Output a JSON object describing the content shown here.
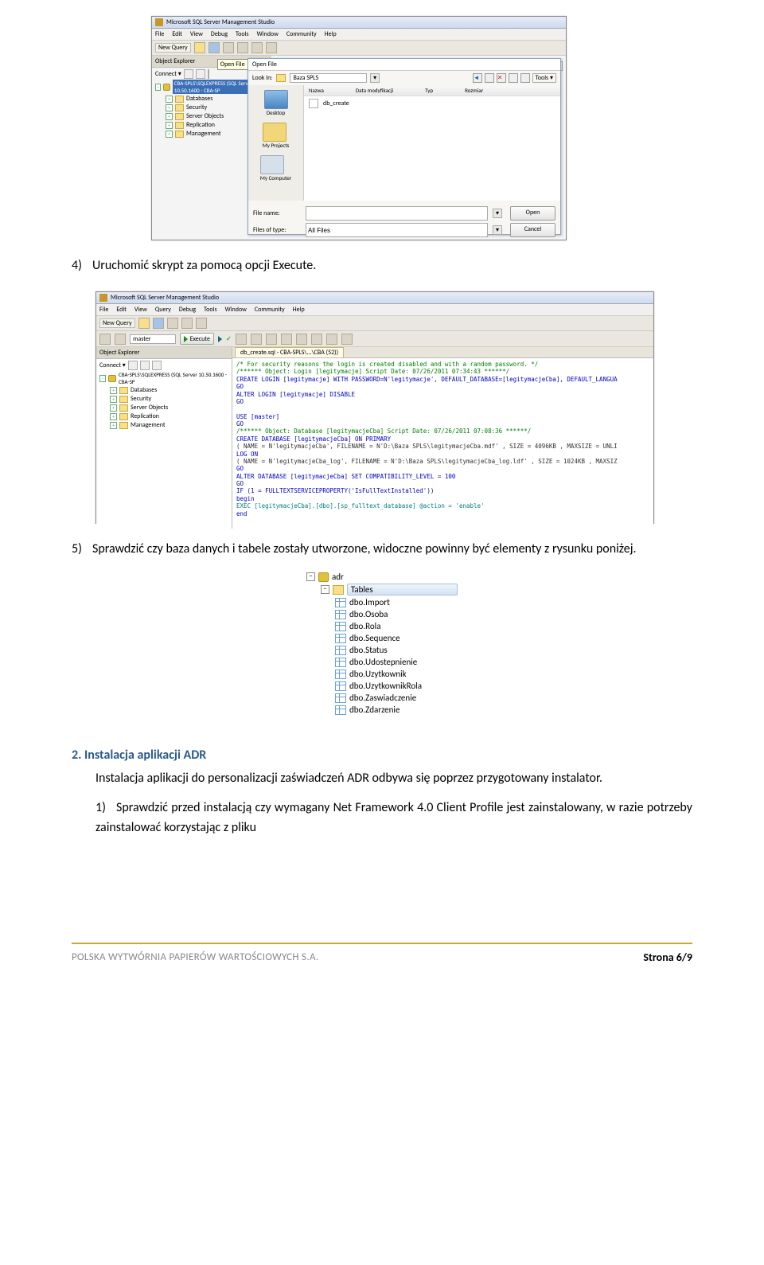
{
  "ssms": {
    "title": "Microsoft SQL Server Management Studio",
    "menu": [
      "File",
      "Edit",
      "View",
      "Debug",
      "Tools",
      "Window",
      "Community",
      "Help"
    ],
    "menu2": [
      "File",
      "Edit",
      "View",
      "Query",
      "Debug",
      "Tools",
      "Window",
      "Community",
      "Help"
    ],
    "new_query": "New Query",
    "oe_title": "Object Explorer",
    "connect": "Connect ▾",
    "server": "CBA-SPLS\\SQLEXPRESS (SQL Server 10.50.1600 - CBA-SP",
    "tree": [
      "Databases",
      "Security",
      "Server Objects",
      "Replication",
      "Management"
    ],
    "tooltip": "Open File",
    "exec": "Execute",
    "sub_master": "master"
  },
  "openfile": {
    "title": "Open File",
    "lookin_lbl": "Look in:",
    "lookin_val": "Baza SPLS",
    "tools": "Tools ▾",
    "side": [
      "Desktop",
      "My Projects",
      "My Computer"
    ],
    "headers": [
      "Nazwa",
      "Data modyfikacji",
      "Typ",
      "Rozmiar"
    ],
    "file": "db_create",
    "filename_lbl": "File name:",
    "filetype_lbl": "Files of type:",
    "filetype_val": "All Files",
    "open": "Open",
    "cancel": "Cancel"
  },
  "editor": {
    "tab": "db_create.sql - CBA-SPLS\\...\\CBA (52))",
    "lines": [
      {
        "t": "/* For security reasons the login is created disabled and with a random password. */",
        "c": "kw-green"
      },
      {
        "t": "/****** Object:  Login [legitymacje]    Script Date: 07/26/2011 07:34:43 ******/",
        "c": "kw-green"
      },
      {
        "t": "CREATE LOGIN [legitymacje] WITH PASSWORD=N'legitymacje', DEFAULT_DATABASE=[legitymacjeCba], DEFAULT_LANGUA",
        "c": "kw-blue"
      },
      {
        "t": "GO",
        "c": "kw-blue"
      },
      {
        "t": "ALTER LOGIN [legitymacje] DISABLE",
        "c": "kw-blue"
      },
      {
        "t": "GO",
        "c": "kw-blue"
      },
      {
        "t": "",
        "c": ""
      },
      {
        "t": "USE [master]",
        "c": "kw-blue"
      },
      {
        "t": "GO",
        "c": "kw-blue"
      },
      {
        "t": "/****** Object:  Database [legitymacjeCba]    Script Date: 07/26/2011 07:08:36 ******/",
        "c": "kw-green"
      },
      {
        "t": "CREATE DATABASE [legitymacjeCba] ON  PRIMARY",
        "c": "kw-blue"
      },
      {
        "t": "( NAME = N'legitymacjeCba', FILENAME = N'D:\\Baza SPLS\\legitymacjeCba.mdf' , SIZE = 4096KB , MAXSIZE = UNLI",
        "c": ""
      },
      {
        "t": " LOG ON",
        "c": "kw-blue"
      },
      {
        "t": "( NAME = N'legitymacjeCba_log', FILENAME = N'D:\\Baza SPLS\\legitymacjeCba_log.ldf' , SIZE = 1024KB , MAXSIZ",
        "c": ""
      },
      {
        "t": "GO",
        "c": "kw-blue"
      },
      {
        "t": "ALTER DATABASE [legitymacjeCba] SET COMPATIBILITY_LEVEL = 100",
        "c": "kw-blue"
      },
      {
        "t": "GO",
        "c": "kw-blue"
      },
      {
        "t": "IF (1 = FULLTEXTSERVICEPROPERTY('IsFullTextInstalled'))",
        "c": "kw-blue"
      },
      {
        "t": "begin",
        "c": "kw-blue"
      },
      {
        "t": "EXEC [legitymacjeCba].[dbo].[sp_fulltext_database] @action = 'enable'",
        "c": "kw-teal"
      },
      {
        "t": "end",
        "c": "kw-blue"
      }
    ]
  },
  "tables": {
    "db": "adr",
    "group": "Tables",
    "items": [
      "dbo.Import",
      "dbo.Osoba",
      "dbo.Rola",
      "dbo.Sequence",
      "dbo.Status",
      "dbo.Udostepnienie",
      "dbo.Uzytkownik",
      "dbo.UzytkownikRola",
      "dbo.Zaswiadczenie",
      "dbo.Zdarzenie"
    ]
  },
  "text": {
    "p4": "Uruchomić skrypt za pomocą opcji Execute.",
    "p5": "Sprawdzić czy baza danych i tabele zostały utworzone, widoczne powinny być elementy z rysunku poniżej.",
    "section2": "2.   Instalacja aplikacji ADR",
    "s2_intro": "Instalacja aplikacji do personalizacji zaświadczeń ADR odbywa się poprzez przygotowany instalator.",
    "s2_1": "Sprawdzić przed instalacją czy wymagany Net Framework 4.0 Client Profile jest zainstalowany, w razie potrzeby zainstalować korzystając z pliku"
  },
  "footer": {
    "company": "POLSKA WYTWÓRNIA PAPIERÓW WARTOŚCIOWYCH S.A.",
    "page": "Strona 6/9"
  }
}
